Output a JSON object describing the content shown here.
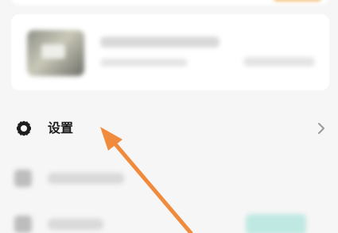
{
  "settings": {
    "label": "设置",
    "icon": "gear-icon",
    "chevron_icon": "chevron-right-icon"
  },
  "colors": {
    "arrow": "#f08a3c",
    "text": "#1a1a1a",
    "chevron": "#9a9a9a",
    "teal_badge": "#bfe8e2"
  }
}
